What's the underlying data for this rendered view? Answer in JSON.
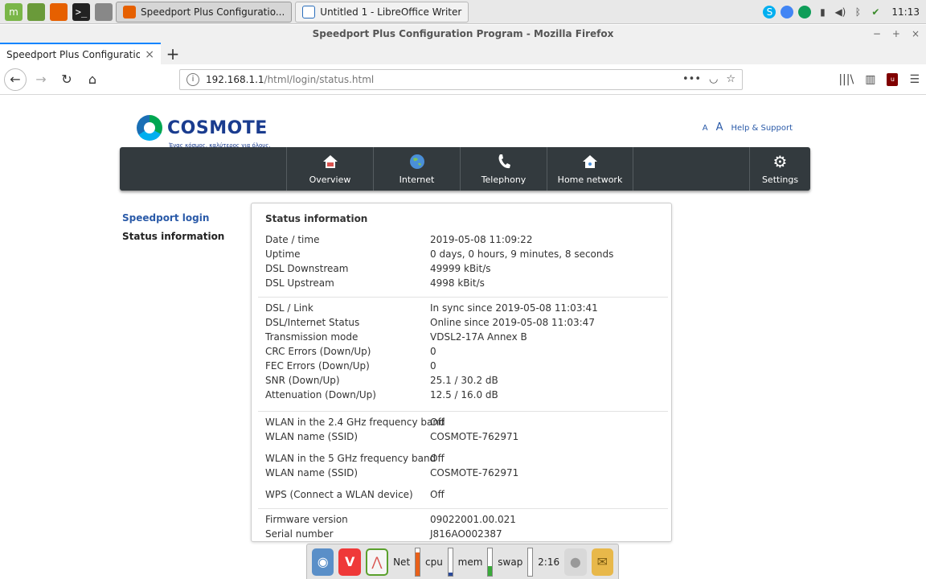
{
  "os_panel": {
    "taskbar": [
      {
        "label": "Speedport Plus Configuratio...",
        "active": true
      },
      {
        "label": "Untitled 1 - LibreOffice Writer",
        "active": false
      }
    ],
    "clock": "11:13"
  },
  "browser": {
    "window_title": "Speedport Plus Configuration Program - Mozilla Firefox",
    "tab_title": "Speedport Plus Configuration Pro",
    "url_host": "192.168.1.1",
    "url_path": "/html/login/status.html"
  },
  "header": {
    "brand": "COSMOTE",
    "tagline": "Ένας κόσμος, καλύτερος για όλους.",
    "font_small": "A",
    "font_large": "A",
    "help_link": "Help & Support"
  },
  "main_nav": [
    {
      "label": "Overview",
      "icon": "home-icon"
    },
    {
      "label": "Internet",
      "icon": "globe-icon"
    },
    {
      "label": "Telephony",
      "icon": "phone-icon"
    },
    {
      "label": "Home network",
      "icon": "home-network-icon"
    },
    {
      "label": "Settings",
      "icon": "gear-icon"
    }
  ],
  "side_nav": {
    "login": "Speedport login",
    "status": "Status information"
  },
  "status": {
    "title": "Status information",
    "rows": [
      {
        "label": "Date / time",
        "value": "2019-05-08 11:09:22"
      },
      {
        "label": "Uptime",
        "value": "0 days, 0 hours, 9 minutes, 8 seconds"
      },
      {
        "label": "DSL Downstream",
        "value": "49999 kBit/s"
      },
      {
        "label": "DSL Upstream",
        "value": "4998 kBit/s"
      },
      {
        "label": "DSL / Link",
        "value": "In sync since 2019-05-08 11:03:41"
      },
      {
        "label": "DSL/Internet Status",
        "value": "Online since 2019-05-08 11:03:47"
      },
      {
        "label": "Transmission mode",
        "value": "VDSL2-17A Annex B"
      },
      {
        "label": "CRC Errors (Down/Up)",
        "value": "0"
      },
      {
        "label": "FEC Errors (Down/Up)",
        "value": "0"
      },
      {
        "label": "SNR (Down/Up)",
        "value": "25.1 / 30.2 dB"
      },
      {
        "label": "Attenuation (Down/Up)",
        "value": "12.5 / 16.0 dB"
      },
      {
        "label": "WLAN in the 2.4 GHz frequency band",
        "value": "Off"
      },
      {
        "label": "WLAN name (SSID)",
        "value": "COSMOTE-762971"
      },
      {
        "label": "WLAN in the 5 GHz frequency band",
        "value": "Off"
      },
      {
        "label": "WLAN name (SSID)",
        "value": "COSMOTE-762971"
      },
      {
        "label": "WPS (Connect a WLAN device)",
        "value": "Off"
      },
      {
        "label": "Firmware version",
        "value": "09022001.00.021"
      },
      {
        "label": "Serial number",
        "value": "J816AO002387"
      }
    ]
  },
  "dock": {
    "net_label": "Net",
    "cpu_label": "cpu",
    "mem_label": "mem",
    "swap_label": "swap",
    "time": "2:16"
  },
  "colors": {
    "nav_bg": "#333a3e",
    "brand_blue": "#1a3c8f",
    "link_blue": "#2a5aa8"
  }
}
